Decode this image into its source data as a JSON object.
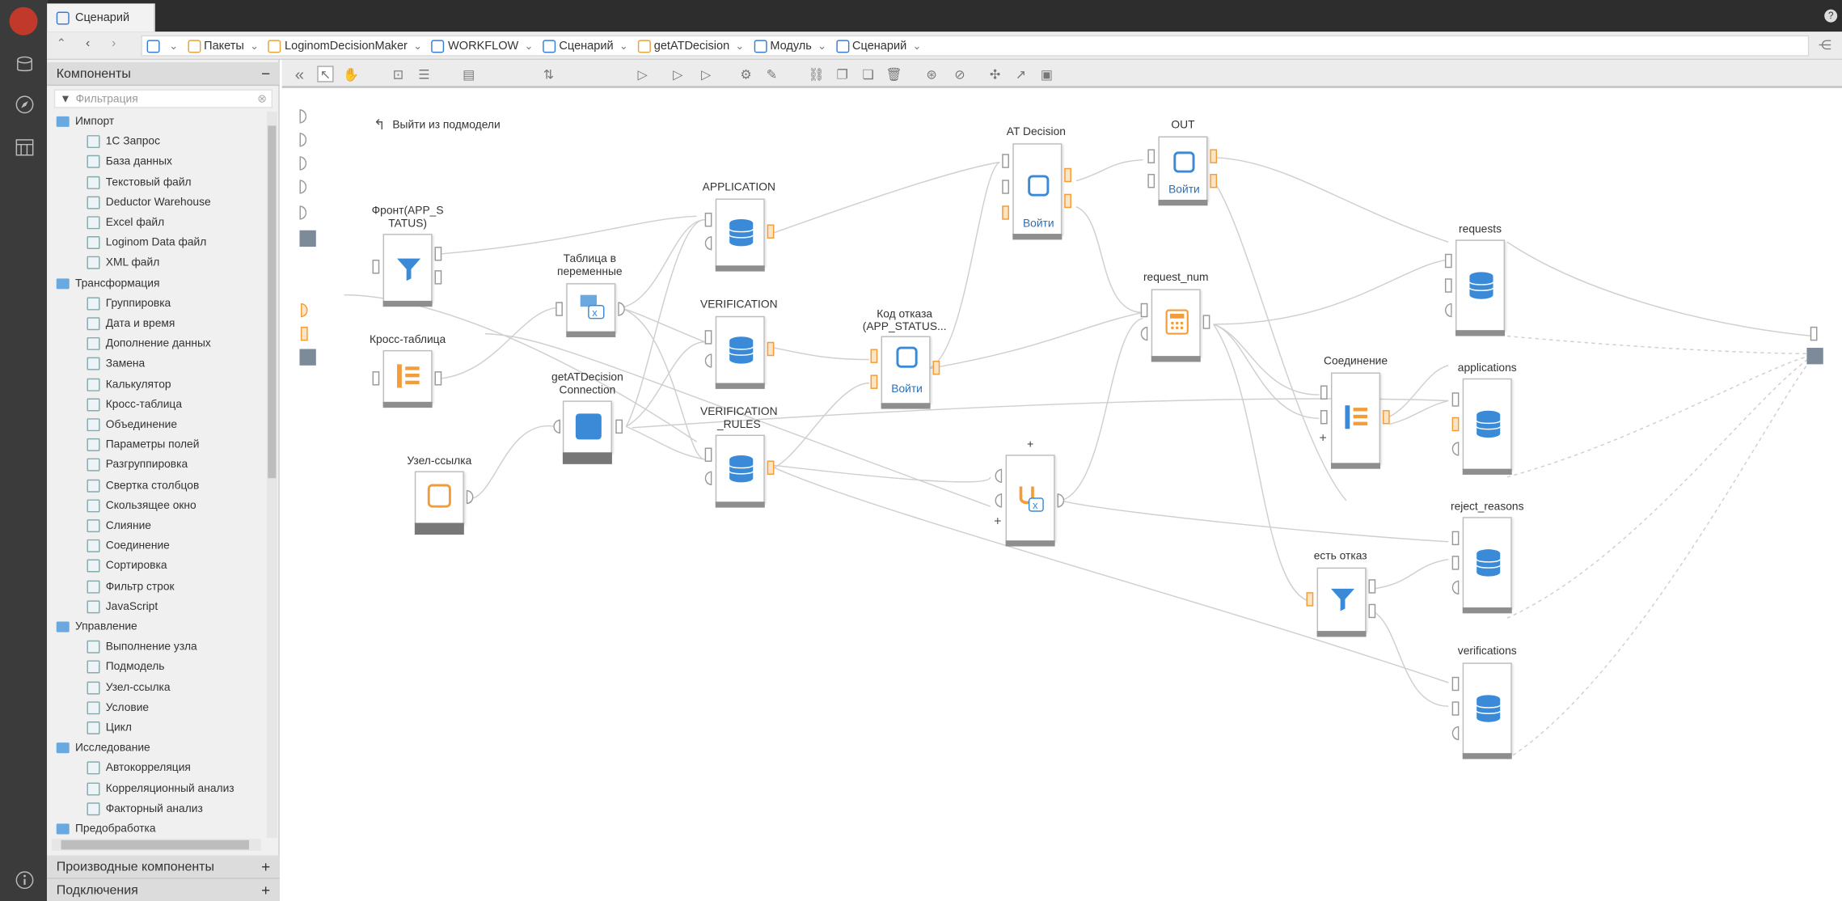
{
  "tab": {
    "label": "Сценарий"
  },
  "breadcrumbs": [
    {
      "label": "Пакеты"
    },
    {
      "label": "LoginomDecisionMaker"
    },
    {
      "label": "WORKFLOW"
    },
    {
      "label": "Сценарий"
    },
    {
      "label": "getATDecision"
    },
    {
      "label": "Модуль"
    },
    {
      "label": "Сценарий"
    }
  ],
  "panel": {
    "components_title": "Компоненты",
    "filter_placeholder": "Фильтрация",
    "derived_title": "Производные компоненты",
    "connections_title": "Подключения",
    "tree": [
      {
        "label": "Импорт",
        "folder": true
      },
      {
        "label": "1С Запрос"
      },
      {
        "label": "База данных"
      },
      {
        "label": "Текстовый файл"
      },
      {
        "label": "Deductor Warehouse"
      },
      {
        "label": "Excel файл"
      },
      {
        "label": "Loginom Data файл"
      },
      {
        "label": "XML файл"
      },
      {
        "label": "Трансформация",
        "folder": true
      },
      {
        "label": "Группировка"
      },
      {
        "label": "Дата и время"
      },
      {
        "label": "Дополнение данных"
      },
      {
        "label": "Замена"
      },
      {
        "label": "Калькулятор"
      },
      {
        "label": "Кросс-таблица"
      },
      {
        "label": "Объединение"
      },
      {
        "label": "Параметры полей"
      },
      {
        "label": "Разгруппировка"
      },
      {
        "label": "Свертка столбцов"
      },
      {
        "label": "Скользящее окно"
      },
      {
        "label": "Слияние"
      },
      {
        "label": "Соединение"
      },
      {
        "label": "Сортировка"
      },
      {
        "label": "Фильтр строк"
      },
      {
        "label": "JavaScript"
      },
      {
        "label": "Управление",
        "folder": true
      },
      {
        "label": "Выполнение узла"
      },
      {
        "label": "Подмодель"
      },
      {
        "label": "Узел-ссылка"
      },
      {
        "label": "Условие"
      },
      {
        "label": "Цикл"
      },
      {
        "label": "Исследование",
        "folder": true
      },
      {
        "label": "Автокорреляция"
      },
      {
        "label": "Корреляционный анализ"
      },
      {
        "label": "Факторный анализ"
      },
      {
        "label": "Предобработка",
        "folder": true
      }
    ]
  },
  "canvas": {
    "exit_label": "Выйти из подмодели",
    "enter_label": "Войти",
    "plus": "+",
    "nodes": {
      "front": "Фронт(APP_S\nTATUS)",
      "cross": "Кросс-таблица",
      "table_vars": "Таблица в\nпеременные",
      "getat": "getATDecision\nConnection",
      "uzel": "Узел-ссылка",
      "application": "APPLICATION",
      "verification": "VERIFICATION",
      "verification_rules": "VERIFICATION\n_RULES",
      "kod": "Код отказа\n(APP_STATUS...",
      "at_decision": "AT Decision",
      "out": "OUT",
      "request_num": "request_num",
      "merge": "+",
      "join": "Соединение",
      "est_otkaz": "есть отказ",
      "requests": "requests",
      "applications": "applications",
      "reject_reasons": "reject_reasons",
      "verifications": "verifications"
    }
  }
}
